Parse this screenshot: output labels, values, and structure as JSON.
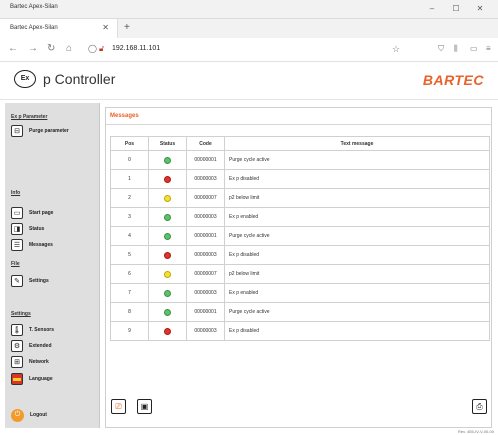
{
  "browser": {
    "window_title": "Bartec Apex-Silan",
    "tab_label": "Bartec Apex-Silan",
    "url": "192.168.11.101",
    "new_tab": "+",
    "window_controls": [
      "–",
      "☐",
      "✕"
    ]
  },
  "app": {
    "logo_text": "Ex",
    "title": "p Controller",
    "brand": "BARTEC",
    "version": "Rev. 455-IV-V-00-00",
    "accent_color": "#e8632b"
  },
  "sidebar": {
    "sections": [
      {
        "title": "Ex p Parameter",
        "items": [
          {
            "label": "Purge parameter",
            "icon": "purge-parameter-icon"
          }
        ]
      },
      {
        "title": "Info",
        "items": [
          {
            "label": "Start page",
            "icon": "start-page-icon"
          },
          {
            "label": "Status",
            "icon": "status-icon"
          },
          {
            "label": "Messages",
            "icon": "messages-icon"
          }
        ]
      },
      {
        "title": "File",
        "items": [
          {
            "label": "Settings",
            "icon": "settings-file-icon"
          }
        ]
      },
      {
        "title": "Settings",
        "items": [
          {
            "label": "T. Sensors",
            "icon": "temperature-sensor-icon"
          },
          {
            "label": "Extended",
            "icon": "extended-icon"
          },
          {
            "label": "Network",
            "icon": "network-icon"
          },
          {
            "label": "Language",
            "icon": "language-flag-icon"
          }
        ]
      }
    ],
    "logout": "Logout"
  },
  "messages": {
    "title": "Messages",
    "columns": [
      "Pos",
      "Status",
      "Code",
      "Text message"
    ],
    "rows": [
      {
        "pos": "0",
        "status": "green",
        "code": "00000001",
        "text": "Purge cycle active"
      },
      {
        "pos": "1",
        "status": "red",
        "code": "00000003",
        "text": "Ex p disabled"
      },
      {
        "pos": "2",
        "status": "yellow",
        "code": "00000007",
        "text": "p2 below limit"
      },
      {
        "pos": "3",
        "status": "green",
        "code": "00000003",
        "text": "Ex p enabled"
      },
      {
        "pos": "4",
        "status": "green",
        "code": "00000001",
        "text": "Purge cycle active"
      },
      {
        "pos": "5",
        "status": "red",
        "code": "00000003",
        "text": "Ex p disabled"
      },
      {
        "pos": "6",
        "status": "yellow",
        "code": "00000007",
        "text": "p2 below limit"
      },
      {
        "pos": "7",
        "status": "green",
        "code": "00000003",
        "text": "Ex p enabled"
      },
      {
        "pos": "8",
        "status": "green",
        "code": "00000001",
        "text": "Purge cycle active"
      },
      {
        "pos": "9",
        "status": "red",
        "code": "00000003",
        "text": "Ex p disabled"
      }
    ]
  }
}
